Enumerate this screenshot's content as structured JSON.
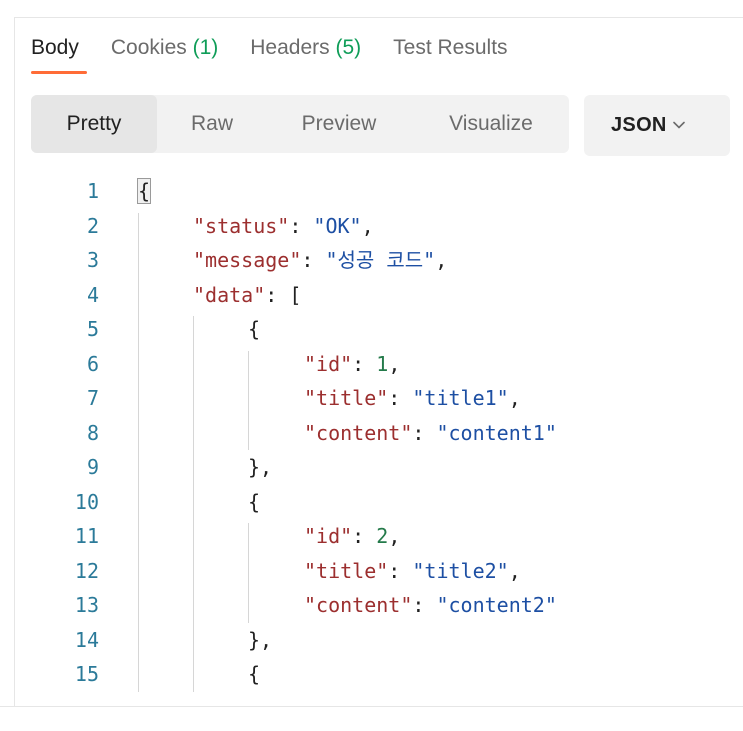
{
  "tabs": [
    {
      "label": "Body",
      "count": ""
    },
    {
      "label": "Cookies",
      "count": "(1)"
    },
    {
      "label": "Headers",
      "count": "(5)"
    },
    {
      "label": "Test Results",
      "count": ""
    }
  ],
  "modes": [
    "Pretty",
    "Raw",
    "Preview",
    "Visualize"
  ],
  "format": {
    "selected": "JSON"
  },
  "colors": {
    "accent": "#ff6c37",
    "count": "#0f9d58",
    "key": "#9c2f2f",
    "string": "#1d4fa3",
    "number": "#247a4a",
    "line_number": "#2b7a99"
  },
  "code_lines": [
    {
      "n": "1",
      "parts": [
        [
          "p",
          "{"
        ]
      ]
    },
    {
      "n": "2",
      "parts": [
        [
          "k",
          "\"status\""
        ],
        [
          "p",
          ": "
        ],
        [
          "s",
          "\"OK\""
        ],
        [
          "p",
          ","
        ]
      ]
    },
    {
      "n": "3",
      "parts": [
        [
          "k",
          "\"message\""
        ],
        [
          "p",
          ": "
        ],
        [
          "s",
          "\"성공 코드\""
        ],
        [
          "p",
          ","
        ]
      ]
    },
    {
      "n": "4",
      "parts": [
        [
          "k",
          "\"data\""
        ],
        [
          "p",
          ": ["
        ]
      ]
    },
    {
      "n": "5",
      "parts": [
        [
          "p",
          "{"
        ]
      ]
    },
    {
      "n": "6",
      "parts": [
        [
          "k",
          "\"id\""
        ],
        [
          "p",
          ": "
        ],
        [
          "n",
          "1"
        ],
        [
          "p",
          ","
        ]
      ]
    },
    {
      "n": "7",
      "parts": [
        [
          "k",
          "\"title\""
        ],
        [
          "p",
          ": "
        ],
        [
          "s",
          "\"title1\""
        ],
        [
          "p",
          ","
        ]
      ]
    },
    {
      "n": "8",
      "parts": [
        [
          "k",
          "\"content\""
        ],
        [
          "p",
          ": "
        ],
        [
          "s",
          "\"content1\""
        ]
      ]
    },
    {
      "n": "9",
      "parts": [
        [
          "p",
          "},"
        ]
      ]
    },
    {
      "n": "10",
      "parts": [
        [
          "p",
          "{"
        ]
      ]
    },
    {
      "n": "11",
      "parts": [
        [
          "k",
          "\"id\""
        ],
        [
          "p",
          ": "
        ],
        [
          "n",
          "2"
        ],
        [
          "p",
          ","
        ]
      ]
    },
    {
      "n": "12",
      "parts": [
        [
          "k",
          "\"title\""
        ],
        [
          "p",
          ": "
        ],
        [
          "s",
          "\"title2\""
        ],
        [
          "p",
          ","
        ]
      ]
    },
    {
      "n": "13",
      "parts": [
        [
          "k",
          "\"content\""
        ],
        [
          "p",
          ": "
        ],
        [
          "s",
          "\"content2\""
        ]
      ]
    },
    {
      "n": "14",
      "parts": [
        [
          "p",
          "},"
        ]
      ]
    },
    {
      "n": "15",
      "parts": [
        [
          "p",
          "{"
        ]
      ]
    }
  ]
}
